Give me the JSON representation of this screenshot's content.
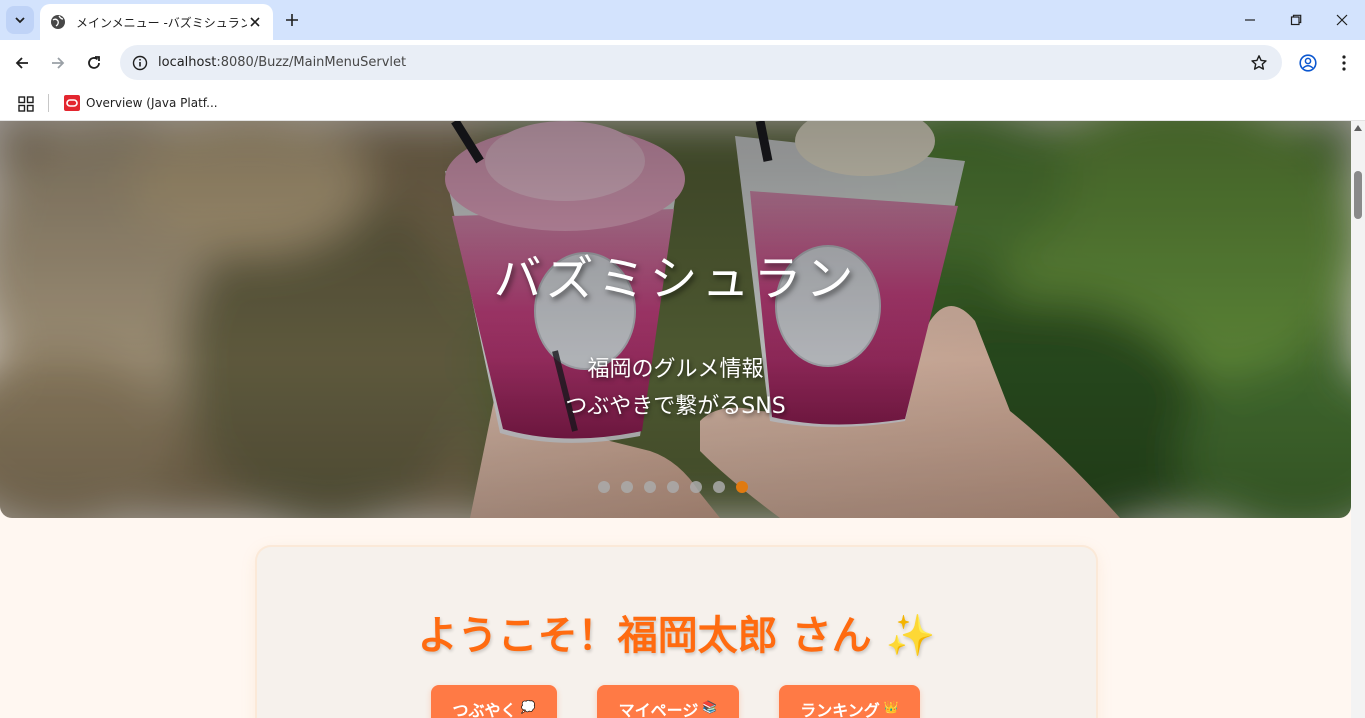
{
  "browser": {
    "tab_title": "メインメニュー -バズミシュラン",
    "url_host": "localhost",
    "url_rest": ":8080/Buzz/MainMenuServlet",
    "bookmark_label": "Overview (Java Platf..."
  },
  "hero": {
    "title": "バズミシュラン",
    "subtitle_line1": "福岡のグルメ情報",
    "subtitle_line2": "つぶやきで繋がるSNS",
    "slide_count": 7,
    "active_slide": 7
  },
  "welcome": {
    "text": "ようこそ！福岡太郎 さん",
    "sparkle": "✨"
  },
  "buttons": {
    "tweet": {
      "label": "つぶやく",
      "emoji": "💭"
    },
    "mypage": {
      "label": "マイページ",
      "emoji": "📚"
    },
    "ranking": {
      "label": "ランキング",
      "emoji": "👑"
    }
  },
  "colors": {
    "accent": "#ff6b10",
    "button": "#ff7a45",
    "active_dot": "#e07a10",
    "page_bg": "#fff7f1"
  }
}
